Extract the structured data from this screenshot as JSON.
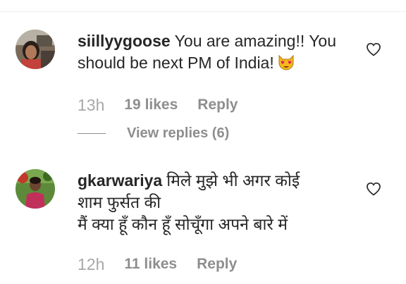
{
  "comments": [
    {
      "username": "siillyygoose",
      "text": "You are amazing!! You should be next PM of India!",
      "emoji": "heart-eyes-cat",
      "time": "13h",
      "likes": "19 likes",
      "reply": "Reply",
      "view_replies": "View replies (6)"
    },
    {
      "username": "gkarwariya",
      "text_line1": "मिले मुझे भी अगर कोई",
      "text_line2": "शाम फुर्सत की",
      "text_line3": "मैं क्या हूँ कौन हूँ सोचूँगा अपने बारे में",
      "time": "12h",
      "likes": "11 likes",
      "reply": "Reply"
    }
  ],
  "colors": {
    "primary_text": "#262626",
    "secondary_text": "#8e8e8e",
    "divider": "#efefef"
  }
}
